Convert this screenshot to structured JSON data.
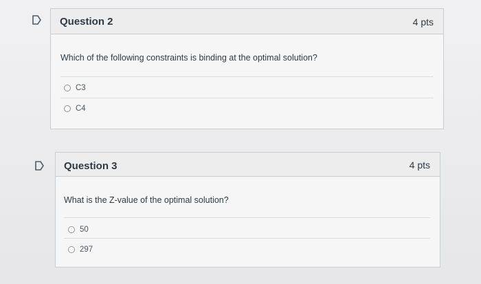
{
  "questions": [
    {
      "title": "Question 2",
      "points": "4 pts",
      "text": "Which of the following constraints is binding at the optimal solution?",
      "options": [
        "C3",
        "C4"
      ]
    },
    {
      "title": "Question 3",
      "points": "4 pts",
      "text": "What is the Z-value of the optimal solution?",
      "options": [
        "50",
        "297"
      ]
    }
  ],
  "icons": {
    "flag": "flag-icon",
    "radio": "radio-button-icon"
  }
}
